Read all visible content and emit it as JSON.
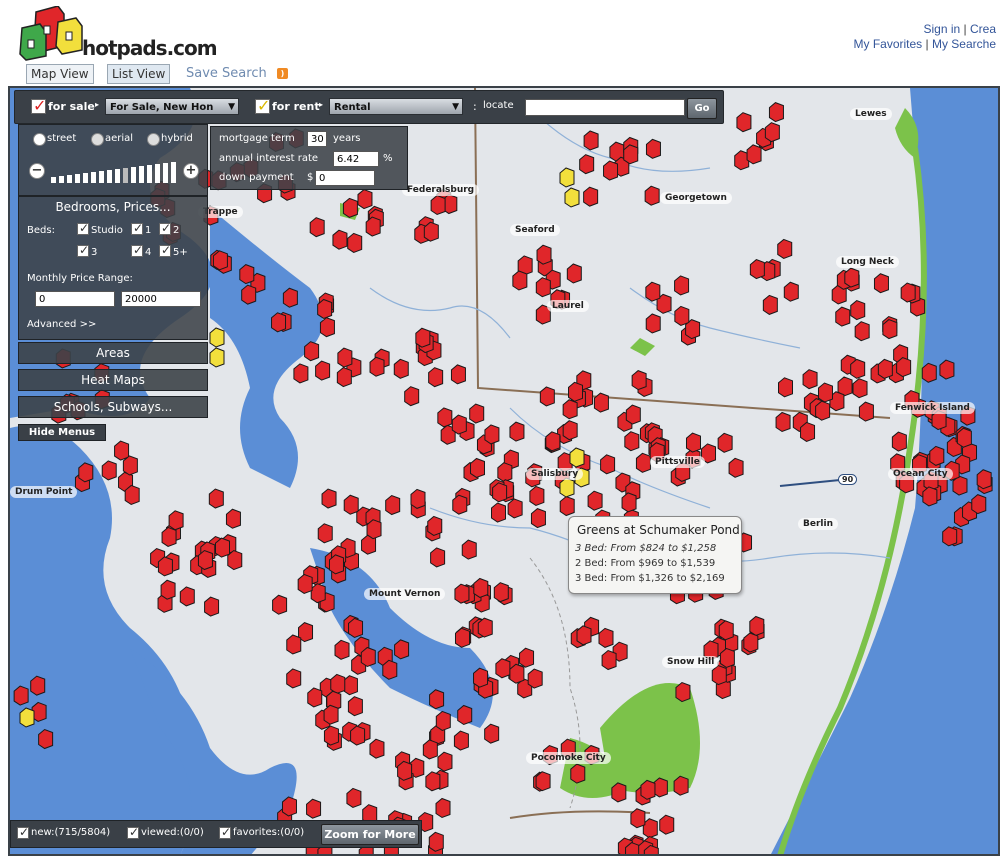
{
  "brand": {
    "logo_text": "hotpads.com"
  },
  "top_links": {
    "sign_in": "Sign in",
    "create": "Crea",
    "favorites": "My Favorites",
    "searches": "My Searche"
  },
  "view_tabs": {
    "map": "Map View",
    "list": "List View",
    "save_search": "Save Search"
  },
  "toolbar": {
    "for_sale": "for sale",
    "for_sale_select": "For Sale, New Hon",
    "for_rent": "for rent",
    "for_rent_select": "Rental",
    "locate": "locate",
    "go": "Go"
  },
  "map_type": {
    "street": "street",
    "aerial": "aerial",
    "hybrid": "hybrid"
  },
  "mortgage": {
    "term_label": "mortgage term",
    "term_value": "30",
    "term_unit": "years",
    "rate_label": "annual interest rate",
    "rate_value": "6.42",
    "rate_unit": "%",
    "down_label": "down payment",
    "down_prefix": "$",
    "down_value": "0"
  },
  "filters": {
    "title": "Bedrooms, Prices...",
    "beds_label": "Beds:",
    "beds_options": [
      "Studio",
      "1",
      "2",
      "3",
      "4",
      "5+"
    ],
    "price_label": "Monthly Price Range:",
    "price_min": "0",
    "price_max": "20000",
    "advanced": "Advanced >>"
  },
  "menus": {
    "areas": "Areas",
    "heat_maps": "Heat Maps",
    "schools": "Schools, Subways...",
    "hide": "Hide Menus"
  },
  "towns": [
    "Lewes",
    "Georgetown",
    "Seaford",
    "Laurel",
    "Long Neck",
    "Fenwick Island",
    "Ocean City",
    "Pittsville",
    "Salisbury",
    "Berlin",
    "Mount Vernon",
    "Snow Hill",
    "Pocomoke City",
    "Federalsburg",
    "Trappe",
    "Drum Point"
  ],
  "route_shield": "90",
  "popup": {
    "title": "Greens at Schumaker Pond",
    "lines": [
      "3 Bed: From $824 to $1,258",
      "2 Bed: From $969 to $1,539",
      "3 Bed: From $1,326 to $2,169"
    ]
  },
  "bottom_bar": {
    "new": "new:(715/5804)",
    "viewed": "viewed:(0/0)",
    "favorites": "favorites:(0/0)",
    "zoom_more": "Zoom for More"
  },
  "colors": {
    "water": "#5b8ed6",
    "land": "#e3e6ea",
    "park": "#7cc24a",
    "marker": "#e0262a",
    "marker_alt": "#f2df3c",
    "panel": "#3a4047"
  }
}
